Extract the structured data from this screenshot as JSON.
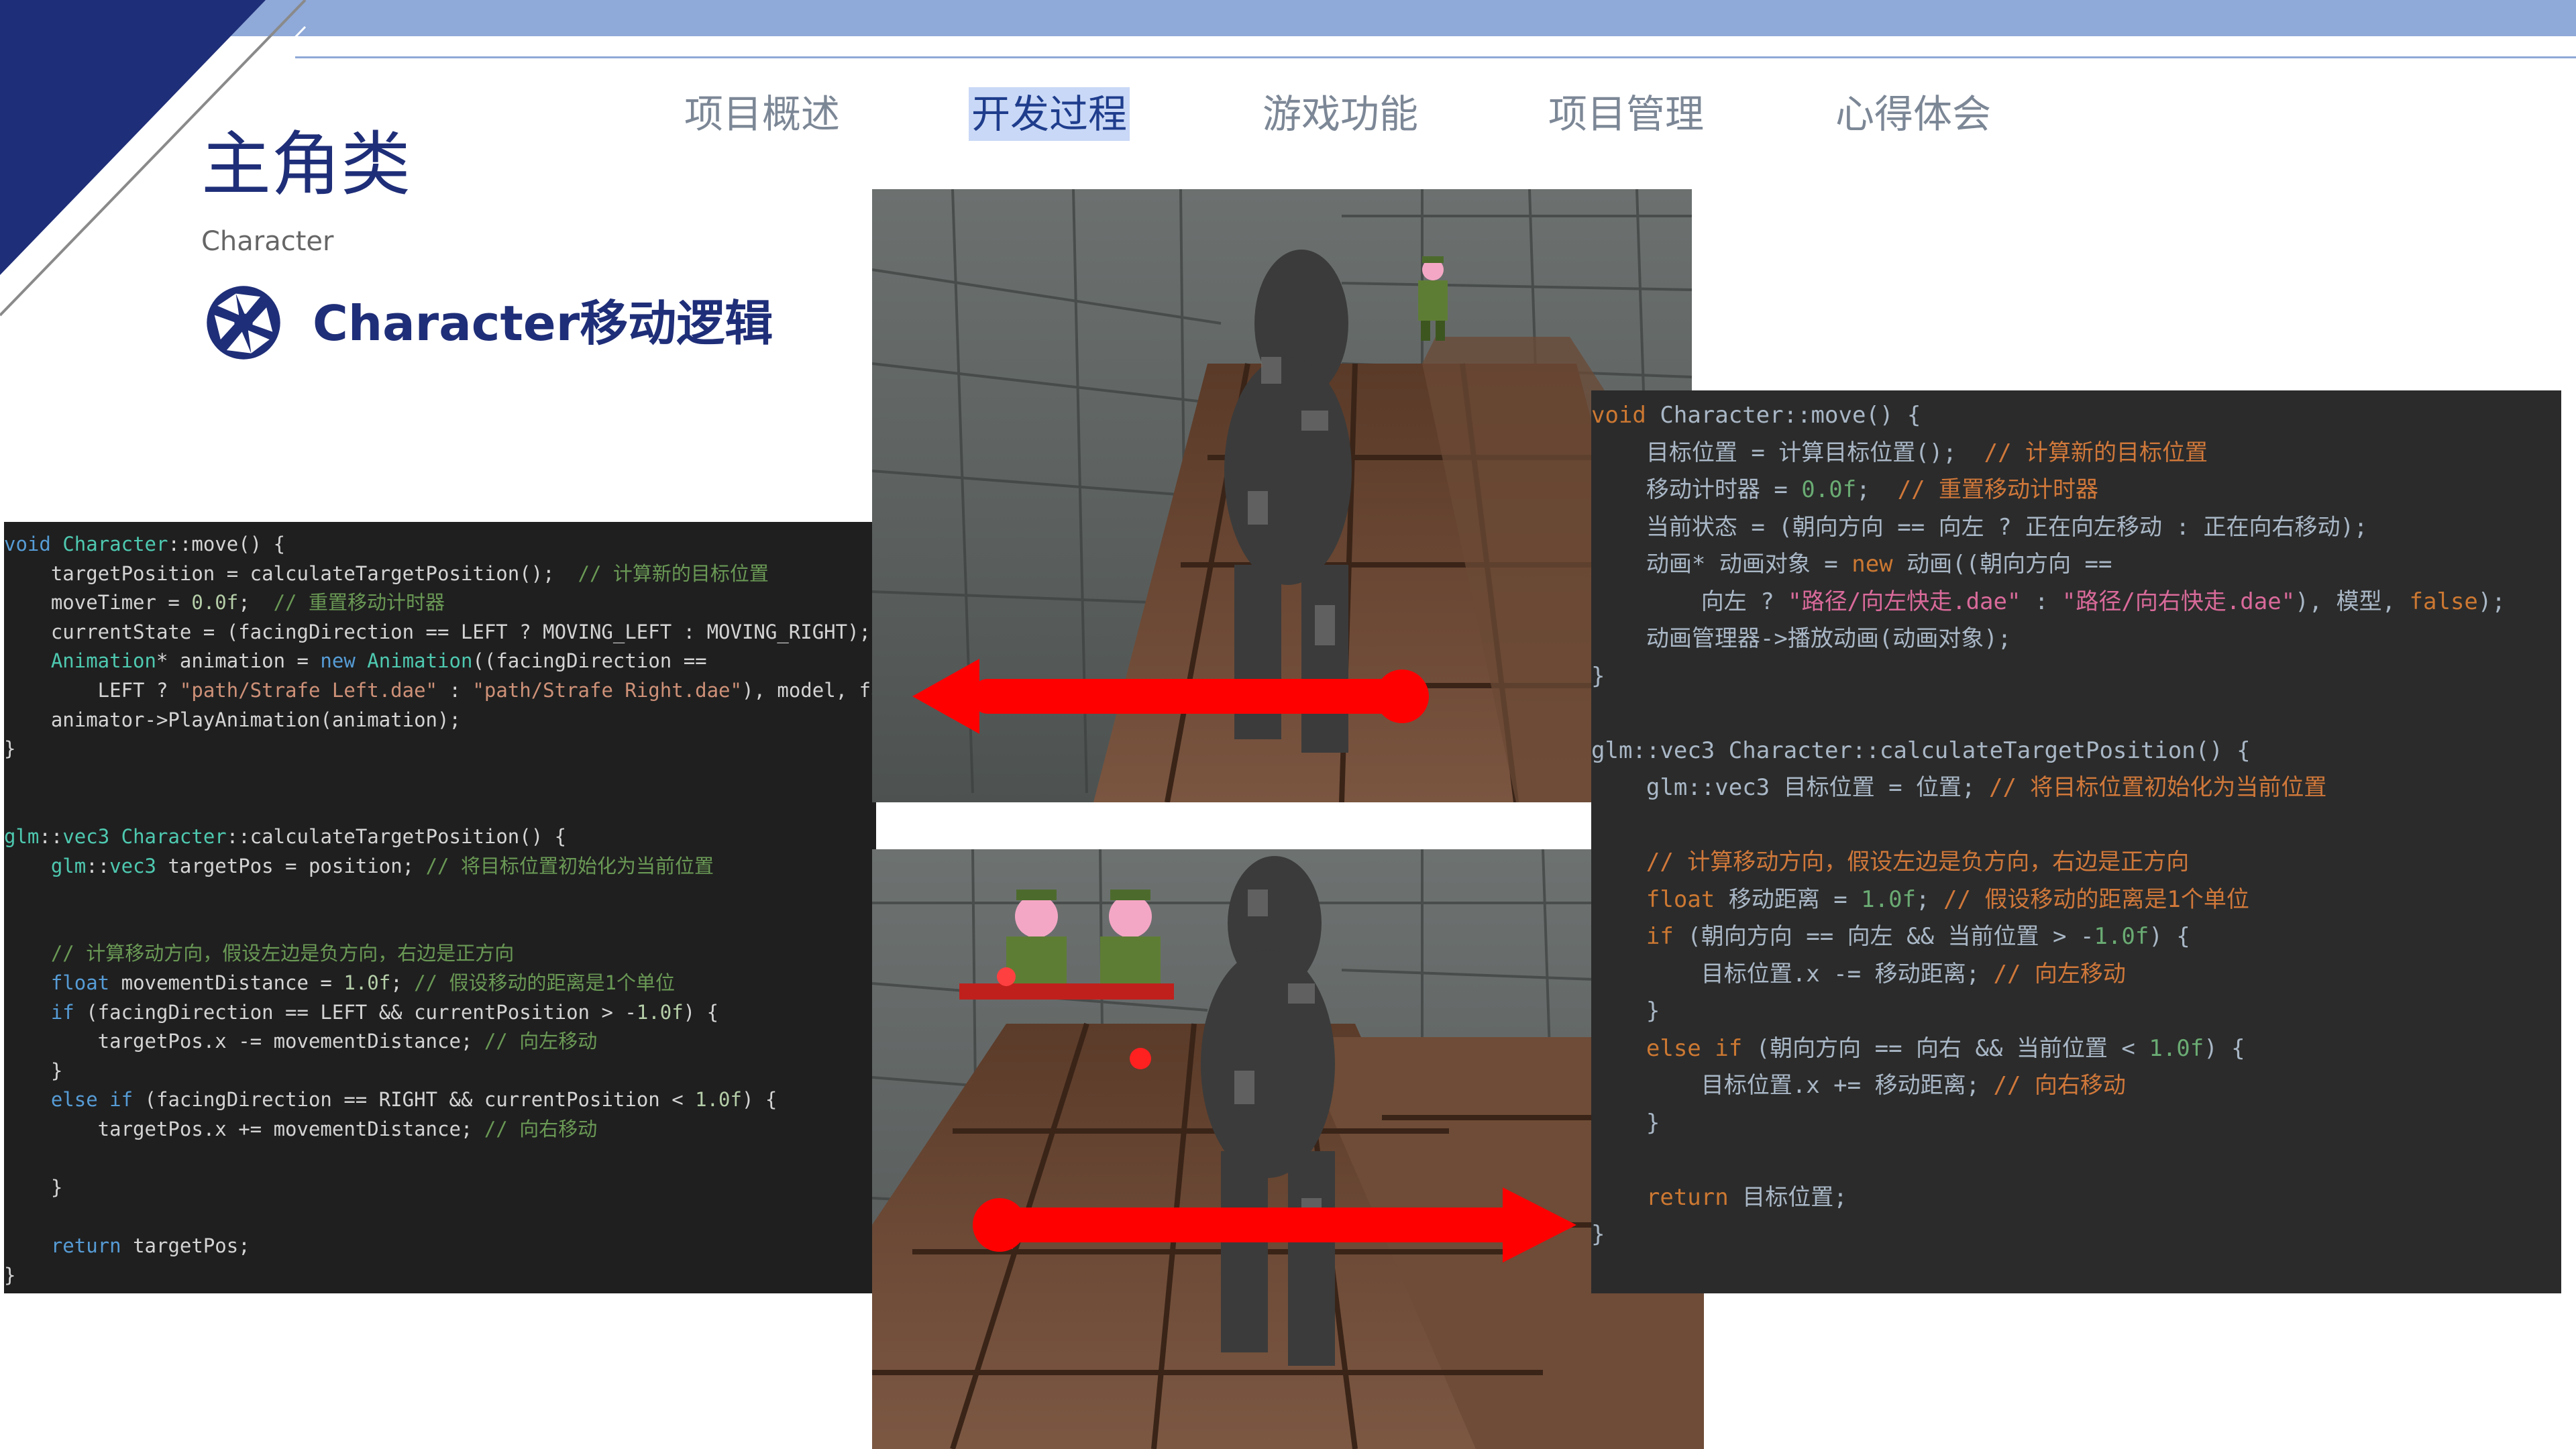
{
  "nav": {
    "items": [
      "项目概述",
      "开发过程",
      "游戏功能",
      "项目管理",
      "心得体会"
    ],
    "active_index": 1
  },
  "title": "主角类",
  "subtitle": "Character",
  "section_title": "Character移动逻辑",
  "colors": {
    "navy": "#1f2e78",
    "accent_blue": "#8fa9d8",
    "arrow_red": "#ff0000"
  },
  "code_left": {
    "lines": [
      "void Character::move() {",
      "    targetPosition = calculateTargetPosition();  // 计算新的目标位置",
      "    moveTimer = 0.0f;  // 重置移动计时器",
      "    currentState = (facingDirection == LEFT ? MOVING_LEFT : MOVING_RIGHT);",
      "    Animation* animation = new Animation((facingDirection ==",
      "        LEFT ? \"path/Strafe Left.dae\" : \"path/Strafe Right.dae\"), model, fa",
      "    animator->PlayAnimation(animation);",
      "}",
      "",
      "",
      "glm::vec3 Character::calculateTargetPosition() {",
      "    glm::vec3 targetPos = position; // 将目标位置初始化为当前位置",
      "",
      "",
      "    // 计算移动方向，假设左边是负方向，右边是正方向",
      "    float movementDistance = 1.0f; // 假设移动的距离是1个单位",
      "    if (facingDirection == LEFT && currentPosition > -1.0f) {",
      "        targetPos.x -= movementDistance; // 向左移动",
      "    }",
      "    else if (facingDirection == RIGHT && currentPosition < 1.0f) {",
      "        targetPos.x += movementDistance; // 向右移动",
      "",
      "    }",
      "",
      "    return targetPos;",
      "}"
    ]
  },
  "code_right": {
    "lines": [
      "void Character::move() {",
      "    目标位置 = 计算目标位置();  // 计算新的目标位置",
      "    移动计时器 = 0.0f;  // 重置移动计时器",
      "    当前状态 = (朝向方向 == 向左 ? 正在向左移动 : 正在向右移动);",
      "    动画* 动画对象 = new 动画((朝向方向 ==",
      "        向左 ? \"路径/向左快走.dae\" : \"路径/向右快走.dae\"), 模型, false);",
      "    动画管理器->播放动画(动画对象);",
      "}",
      "",
      "glm::vec3 Character::calculateTargetPosition() {",
      "    glm::vec3 目标位置 = 位置; // 将目标位置初始化为当前位置",
      "",
      "    // 计算移动方向，假设左边是负方向，右边是正方向",
      "    float 移动距离 = 1.0f; // 假设移动的距离是1个单位",
      "    if (朝向方向 == 向左 && 当前位置 > -1.0f) {",
      "        目标位置.x -= 移动距离; // 向左移动",
      "    }",
      "    else if (朝向方向 == 向右 && 当前位置 < 1.0f) {",
      "        目标位置.x += 移动距离; // 向右移动",
      "    }",
      "",
      "    return 目标位置;",
      "}"
    ]
  }
}
